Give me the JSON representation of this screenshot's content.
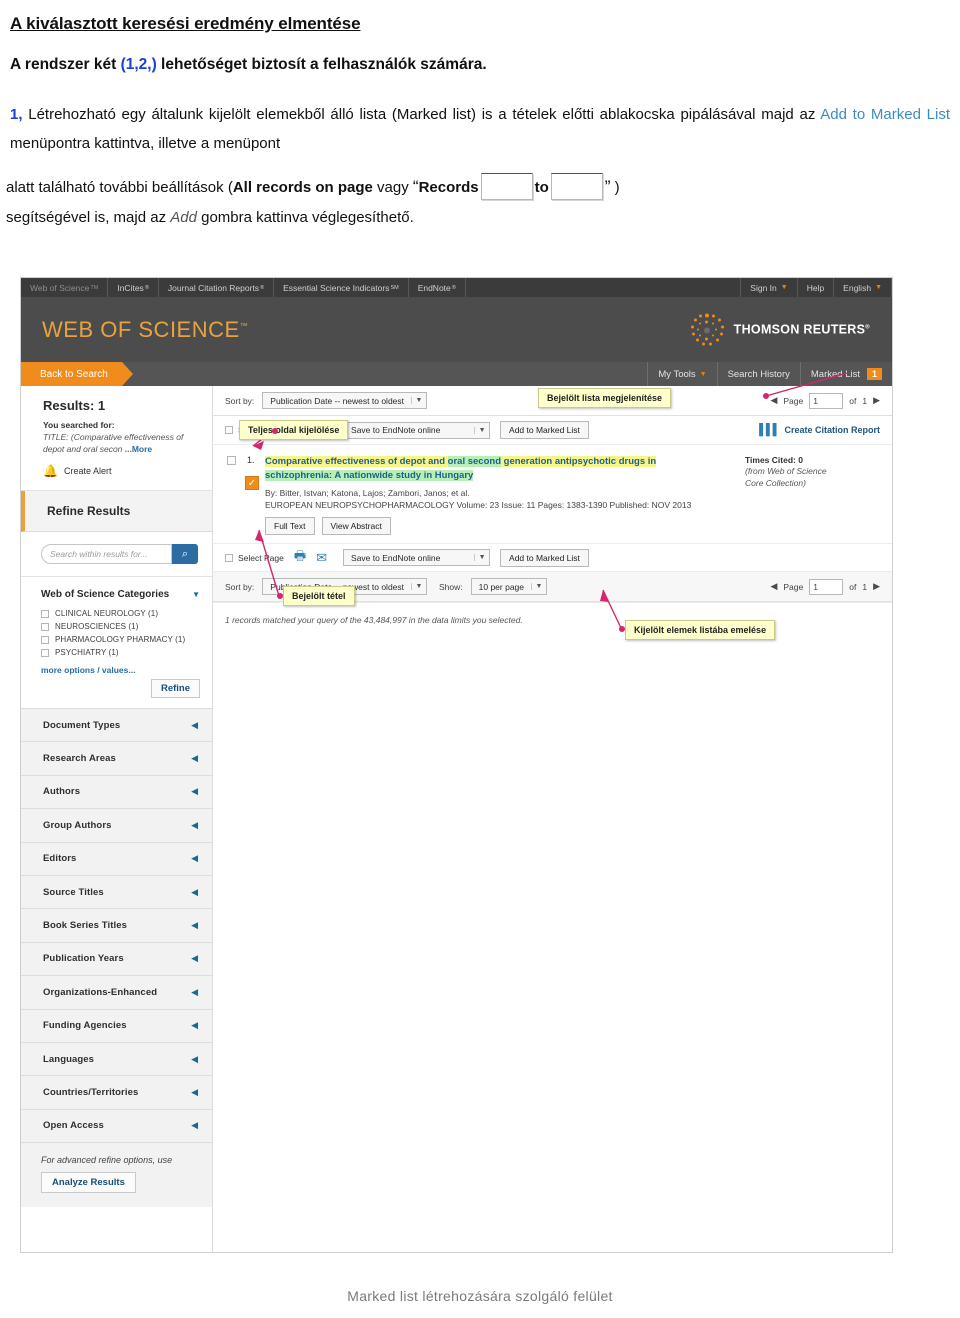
{
  "document": {
    "heading": "A kiválasztott keresési eredmény elmentése",
    "intro_before": "A rendszer két ",
    "intro_blue": "(1,2,)",
    "intro_after": " lehetőséget biztosít a felhasználók számára.",
    "p1_marker": "1,",
    "p1_a": " Létrehozható egy általunk kijelölt elemekből álló lista (Marked list) is a tételek előtti ablakocska pipálásával majd az ",
    "p1_link": "Add to Marked List",
    "p1_b": " menüpontra kattintva, illetve a menüpont",
    "p2_a": "alatt található további beállítások (",
    "p2_bold1": "All records on page",
    "p2_b": " vagy ",
    "p2_quote_open": "“",
    "p2_bold2": "Records",
    "p2_to": "to",
    "p2_quote_close": "”",
    "p2_paren": ")",
    "p3_a": "segítségével is, majd az ",
    "p3_ital": "Add",
    "p3_b": " gombra kattinva véglegesíthető."
  },
  "caption": "Marked list létrehozására szolgáló felület",
  "screenshot": {
    "topnav": {
      "items": [
        {
          "label": "Web of Science",
          "sup": "TM"
        },
        {
          "label": "InCites",
          "sup": "®"
        },
        {
          "label": "Journal Citation Reports",
          "sup": "®"
        },
        {
          "label": "Essential Science Indicators",
          "sup": "SM"
        },
        {
          "label": "EndNote",
          "sup": "®"
        }
      ],
      "right_items": [
        {
          "label": "Sign In",
          "caret": "▼"
        },
        {
          "label": "Help",
          "caret": ""
        },
        {
          "label": "English",
          "caret": "▼"
        }
      ]
    },
    "banner": {
      "logo": "WEB OF SCIENCE",
      "logo_tm": "™",
      "brand": "THOMSON REUTERS",
      "brand_reg": "®"
    },
    "subnav": {
      "back_to_search": "Back to Search",
      "right_items": [
        {
          "label": "My Tools",
          "caret": "▼",
          "badge": ""
        },
        {
          "label": "Search History",
          "caret": "",
          "badge": ""
        },
        {
          "label": "Marked List",
          "caret": "",
          "badge": "1"
        }
      ]
    },
    "sidebar": {
      "results_title": "Results: 1",
      "searched_for_label": "You searched for:",
      "query_prefix": "TITLE:",
      "query_text": "(Comparative effectiveness of depot and oral secon ",
      "more_label": "...More",
      "create_alert": "Create Alert",
      "refine_results": "Refine Results",
      "search_within_placeholder": "Search within results for...",
      "search_icon": "⌕",
      "categories_header": "Web of Science Categories",
      "categories": [
        "CLINICAL NEUROLOGY (1)",
        "NEUROSCIENCES (1)",
        "PHARMACOLOGY PHARMACY (1)",
        "PSYCHIATRY (1)"
      ],
      "more_options": "more options / values...",
      "refine_button": "Refine",
      "facets": [
        "Document Types",
        "Research Areas",
        "Authors",
        "Group Authors",
        "Editors",
        "Source Titles",
        "Book Series Titles",
        "Publication Years",
        "Organizations-Enhanced",
        "Funding Agencies",
        "Languages",
        "Countries/Territories",
        "Open Access"
      ],
      "advanced_note": "For advanced refine options, use",
      "analyze_button": "Analyze Results"
    },
    "results": {
      "sort_by_label": "Sort by:",
      "sort_value": "Publication Date -- newest to oldest",
      "show_label": "Show:",
      "show_value": "10 per page",
      "page_label": "Page",
      "page_value": "1",
      "page_of": "of",
      "page_total": "1",
      "select_page": "Select Page",
      "save_endnote": "Save to EndNote online",
      "add_to_marked_list": "Add to Marked List",
      "create_citation_report": "Create Citation Report",
      "record": {
        "number": "1.",
        "title_part1": "Comparative effectiveness of depot and ",
        "title_part2": "oral second",
        "title_part3": " generation antipsychotic drugs in ",
        "title_part4": "schizophrenia: A nationwide study in Hungary",
        "authors": "By: Bitter, Istvan; Katona, Lajos; Zambori, Janos; et al.",
        "meta": "EUROPEAN NEUROPSYCHOPHARMACOLOGY  Volume: 23   Issue: 11   Pages: 1383-1390   Published: NOV 2013",
        "full_text": "Full Text",
        "view_abstract": "View Abstract",
        "times_cited": "Times Cited: 0",
        "source_line1": "(from Web of Science",
        "source_line2": "Core Collection)"
      },
      "count_line": "1 records matched your query of the 43,484,997 in the data limits you selected."
    },
    "tooltips": [
      {
        "text": "Bejelölt lista megjelenítése"
      },
      {
        "text": "Teljes oldal kijelölése"
      },
      {
        "text": "Bejelölt tétel"
      },
      {
        "text": "Kijelölt elemek listába emelése"
      }
    ]
  },
  "colors": {
    "orange": "#f08c1b",
    "link_blue": "#3c8dbc",
    "tooltip_bg": "#ffffcc",
    "pink": "#d4256e",
    "dark_nav": "#3b3b3b"
  }
}
